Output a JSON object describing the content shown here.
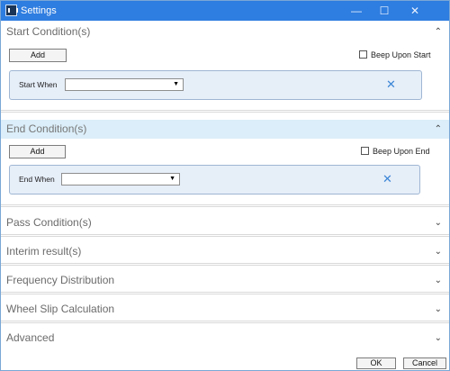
{
  "window": {
    "title": "Settings",
    "minimize": "—",
    "maximize": "☐",
    "close": "✕"
  },
  "sections": {
    "start": {
      "header": "Start Condition(s)",
      "add_label": "Add",
      "beep_label": "Beep Upon Start",
      "condition_label": "Start When",
      "condition_value": ""
    },
    "end": {
      "header": "End Condition(s)",
      "add_label": "Add",
      "beep_label": "Beep Upon End",
      "condition_label": "End When",
      "condition_value": ""
    },
    "pass": {
      "header": "Pass Condition(s)"
    },
    "interim": {
      "header": "Interim result(s)"
    },
    "frequency": {
      "header": "Frequency Distribution"
    },
    "wheelslip": {
      "header": "Wheel Slip Calculation"
    },
    "advanced": {
      "header": "Advanced"
    }
  },
  "icons": {
    "expand": "⌃",
    "collapse": "⌄",
    "dropdown": "▼",
    "remove": "✕"
  },
  "footer": {
    "ok_label": "OK",
    "cancel_label": "Cancel"
  },
  "colors": {
    "titlebar": "#2e7de0",
    "active_header": "#dbeef9",
    "condition_box": "#e6eef8",
    "remove_icon": "#3b86d6"
  }
}
